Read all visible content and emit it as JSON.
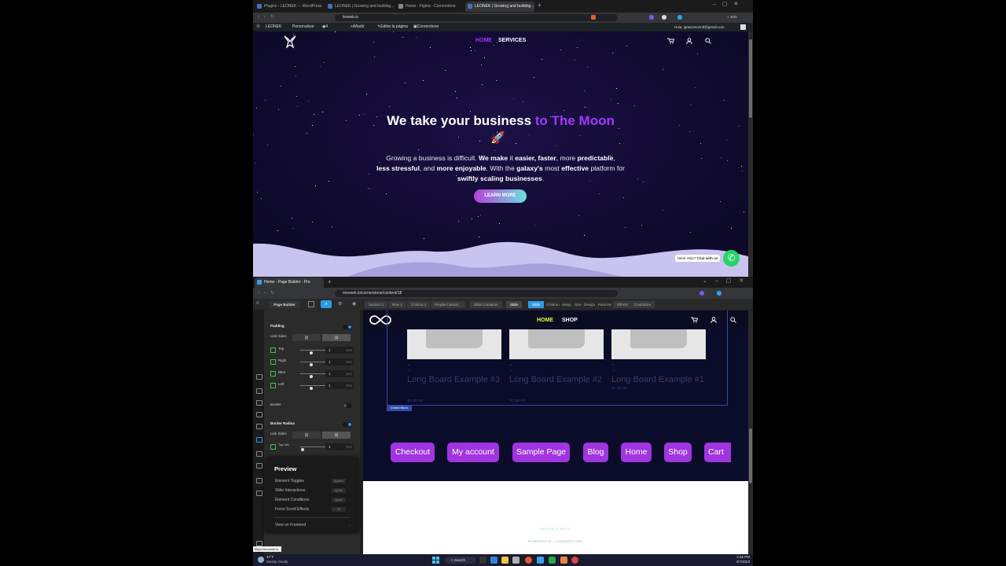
{
  "top_browser": {
    "tabs": [
      {
        "label": "Plugins ‹ LEONEK — WordPress"
      },
      {
        "label": "LEONEK | Growing and building..."
      },
      {
        "label": "Home - Figma - Cornerstone"
      },
      {
        "label": "LEONEK | Growing and building..."
      }
    ],
    "url": "leonek.io",
    "zoom": "+ 10%",
    "wp_admin_bar": {
      "site": "LEONEK",
      "customize": "Personalizar",
      "comments": "4",
      "new": "Añadir",
      "edit_page": "Editar la página",
      "cornerstone": "Cornerstone",
      "user": "Hola, ignaciosonrid@gmail.com"
    },
    "site_nav": {
      "home": "HOME",
      "services": "SERVICES"
    },
    "hero": {
      "title_plain": "We take your business ",
      "title_accent": "to The Moon",
      "rocket": "🚀",
      "subtitle_1": "Growing a business is difficult. ",
      "subtitle_b1": "We make",
      "subtitle_2": " it ",
      "subtitle_b2": "easier, faster",
      "subtitle_3": ", more ",
      "subtitle_b3": "predictable",
      "subtitle_4": ",",
      "subtitle_b4": "less stressful",
      "subtitle_5": ", and ",
      "subtitle_b5": "more enjoyable",
      "subtitle_6": ". With the ",
      "subtitle_b6": "galaxy's",
      "subtitle_7": " most ",
      "subtitle_b7": "effective",
      "subtitle_8": " platform for ",
      "subtitle_b8": "swiftly scaling businesses",
      "subtitle_9": ".",
      "cta": "LEARN MORE"
    },
    "whatsapp": {
      "prefix": "Need Help? ",
      "link": "Chat with us"
    }
  },
  "bottom_browser": {
    "tab_label": "Home - Page Builder - Pro",
    "url": "moveek.io/cornerstone/content/18",
    "builder": {
      "title": "Page Builder",
      "breadcrumbs": [
        "Section 3",
        "Row 1",
        "Column 1",
        "People Carous...",
        "Slide Container",
        "Slide"
      ],
      "tabs": [
        "Slide",
        "Children",
        "Setup",
        "Size",
        "Design",
        "Particles",
        "Effects",
        "Customize"
      ],
      "active_tab": "Slide"
    },
    "panel": {
      "padding_label": "Padding",
      "link_sides": "Link Sides",
      "sides": [
        {
          "label": "Top",
          "value": "1",
          "unit": "rem"
        },
        {
          "label": "Right",
          "value": "1",
          "unit": "rem"
        },
        {
          "label": "Bttm",
          "value": "1",
          "unit": "rem"
        },
        {
          "label": "Left",
          "value": "1",
          "unit": "rem"
        }
      ],
      "border_label": "Border",
      "border_radius_label": "Border Radius",
      "radius_row": {
        "label": "Top Left",
        "value": "1",
        "unit": "rem"
      }
    },
    "preview": {
      "title": "Preview",
      "rows": [
        {
          "label": "Element Toggles",
          "tag": "Applied"
        },
        {
          "label": "Slide Interactions",
          "tag": "Ignore"
        },
        {
          "label": "Element Conditions",
          "tag": "Ignore"
        },
        {
          "label": "Force Scroll Effects",
          "tag": "Off"
        }
      ],
      "frontend": "View on Frontend"
    },
    "site_nav": {
      "home": "HOME",
      "shop": "SHOP"
    },
    "cards": [
      {
        "title": "Long Board Example #3",
        "price": "$1,300.00"
      },
      {
        "title": "Long Board Example #2",
        "price": "$1,300.00"
      },
      {
        "title": "Long Board Example #1",
        "price": "$1,300.00"
      }
    ],
    "global_block": "Global Block",
    "footer_links": [
      "Checkout",
      "My account",
      "Sample Page",
      "Blog",
      "Home",
      "Shop",
      "Cart"
    ],
    "footer_small": [
      "DESIGN & BUILD",
      "POWERED BY CORNERSTONE"
    ],
    "link_tooltip": "https://moveek.io"
  },
  "taskbar": {
    "weather_temp": "47°F",
    "weather_desc": "Mostly cloudy",
    "search": "Search",
    "time": "2:46 PM",
    "date": "3/7/2023"
  },
  "colors": {
    "accent_purple": "#a238ff",
    "pill_purple": "#a035e0",
    "whatsapp_green": "#25d366",
    "hero_bg": "#0f0a2c"
  }
}
